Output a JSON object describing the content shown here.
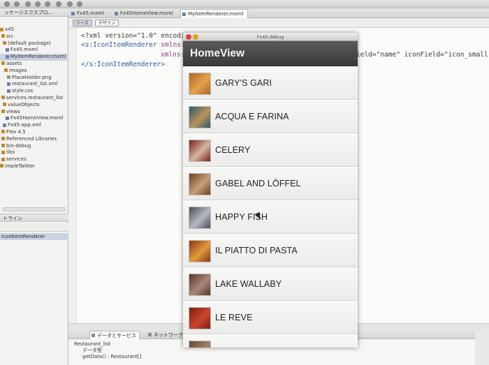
{
  "ide": {
    "package_explorer_tab": "ッケージエクスプロ...",
    "tree": [
      {
        "label": "x45",
        "kind": "folder"
      },
      {
        "label": "src",
        "kind": "folder"
      },
      {
        "label": "(default package)",
        "kind": "folder"
      },
      {
        "label": "Fx45.mxml",
        "kind": "file"
      },
      {
        "label": "MyItemRenderer.mxml",
        "kind": "file",
        "selected": true
      },
      {
        "label": "assets",
        "kind": "folder"
      },
      {
        "label": "images",
        "kind": "folder"
      },
      {
        "label": "PlaceHolder.png",
        "kind": "img"
      },
      {
        "label": "restaurant_list.xml",
        "kind": "file"
      },
      {
        "label": "style.css",
        "kind": "file"
      },
      {
        "label": "services.restaurant_list",
        "kind": "folder"
      },
      {
        "label": "valueObjects",
        "kind": "folder"
      },
      {
        "label": "views",
        "kind": "folder"
      },
      {
        "label": "Fx45HomeView.mxml",
        "kind": "file"
      },
      {
        "label": "Fx45-app.xml",
        "kind": "file"
      },
      {
        "label": "Flex 4.5",
        "kind": "folder"
      },
      {
        "label": "Referenced Libraries",
        "kind": "folder"
      },
      {
        "label": "bin-debug",
        "kind": "folder"
      },
      {
        "label": "libs",
        "kind": "folder"
      },
      {
        "label": "services",
        "kind": "folder"
      },
      {
        "label": "impleTwitter",
        "kind": "folder"
      }
    ],
    "outline_tab": "トライン",
    "outline_item": "IconItemRenderer",
    "editor_tabs": [
      "Fx45.mxml",
      "Fx45HomeView.mxml",
      "MyItemRenderer.mxml"
    ],
    "mode_source": "ソース",
    "mode_design": "デザイン",
    "code_line1": "<?xml version=\"1.0\" encodi",
    "code_line2_tag": "<s:IconItemRenderer",
    "code_line2_attr": "xmlns:",
    "code_line3_attr": "xmlns:",
    "code_line4_tag": "</s:IconItemRenderer>",
    "code_right": "ield=\"name\" iconField=\"icon_small\"",
    "bottom_tabs": [
      "データとサービス",
      "ネットワーク"
    ],
    "bottom_rows": [
      "Restaurant_list",
      "データ型",
      "getData() : Restaurant[]"
    ]
  },
  "simulator": {
    "window_title": "Fx45-debug",
    "traffic_colors": [
      "#e0443e",
      "#dea123",
      "#9a9a98"
    ],
    "view_title": "HomeView",
    "items": [
      {
        "label": "GARY'S GARI",
        "thumb": [
          "#b0642a",
          "#e3a34b"
        ]
      },
      {
        "label": "ACQUA E FARINA",
        "thumb": [
          "#2d5a6b",
          "#b8945a"
        ]
      },
      {
        "label": "CELERY",
        "thumb": [
          "#7a1f17",
          "#d2b6a2"
        ]
      },
      {
        "label": "GABEL AND LÖFFEL",
        "thumb": [
          "#6d3f24",
          "#c7a07a"
        ]
      },
      {
        "label": "HAPPY FISH",
        "thumb": [
          "#4b4d57",
          "#b6b8c2"
        ]
      },
      {
        "label": "IL PIATTO DI PASTA",
        "thumb": [
          "#8a3512",
          "#e29a3e"
        ]
      },
      {
        "label": "LAKE WALLABY",
        "thumb": [
          "#5a3524",
          "#a9877a"
        ]
      },
      {
        "label": "LE REVE",
        "thumb": [
          "#7c1e12",
          "#c8462c"
        ]
      },
      {
        "label": "",
        "thumb": [
          "#6b4a33",
          "#a48062"
        ]
      }
    ]
  }
}
